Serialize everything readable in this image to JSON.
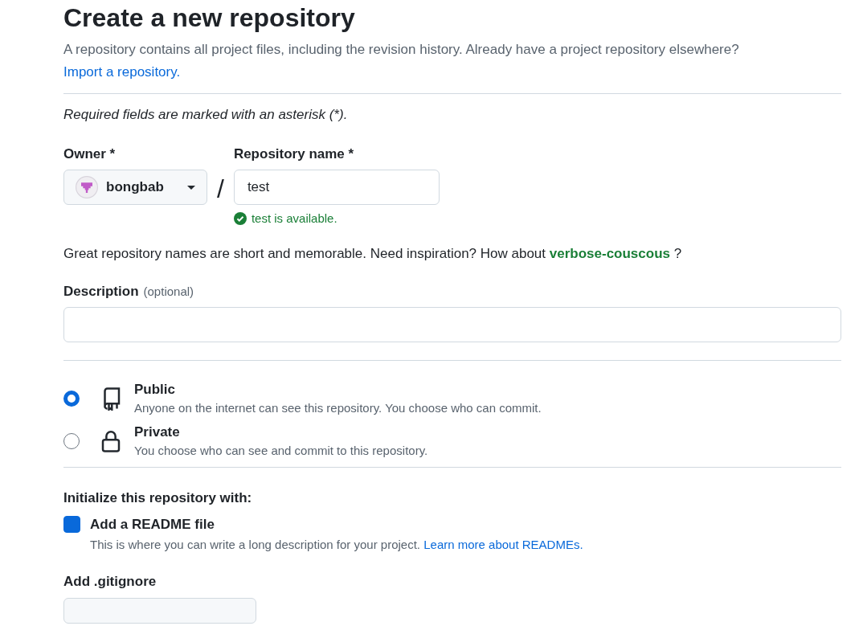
{
  "title": "Create a new repository",
  "intro": "A repository contains all project files, including the revision history. Already have a project repository elsewhere?",
  "import_link": "Import a repository.",
  "required_note": "Required fields are marked with an asterisk (*).",
  "owner": {
    "label": "Owner *",
    "value": "bongbab"
  },
  "separator": "/",
  "repo_name": {
    "label": "Repository name *",
    "value": "test",
    "status": "test is available."
  },
  "suggestion": {
    "text": "Great repository names are short and memorable. Need inspiration? How about",
    "name": "verbose-couscous",
    "after": "?"
  },
  "description": {
    "label": "Description",
    "optional": "(optional)"
  },
  "visibility": [
    {
      "kind": "book",
      "label": "Public",
      "hint": "Anyone on the internet can see this repository. You choose who can commit.",
      "selected": true
    },
    {
      "kind": "lock",
      "label": "Private",
      "hint": "You choose who can see and commit to this repository.",
      "selected": false
    }
  ],
  "initialize": {
    "heading": "Initialize this repository with:",
    "readme": {
      "label": "Add a README file",
      "checked": true,
      "hint": "This is where you can write a long description for your project.",
      "link": "Learn more about READMEs."
    }
  },
  "gitignore": {
    "label": "Add .gitignore"
  }
}
